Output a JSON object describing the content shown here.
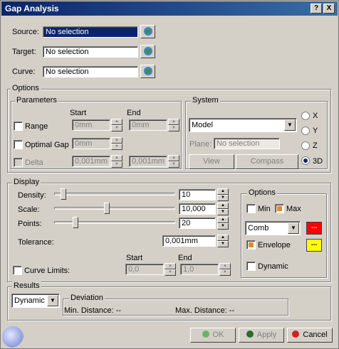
{
  "window": {
    "title": "Gap Analysis",
    "help_label": "?",
    "close_label": "X"
  },
  "inputs": {
    "source": {
      "label": "Source:",
      "value": "No selection"
    },
    "target": {
      "label": "Target:",
      "value": "No selection"
    },
    "curve": {
      "label": "Curve:",
      "value": "No selection"
    }
  },
  "options": {
    "title": "Options",
    "parameters": {
      "title": "Parameters",
      "start_header": "Start",
      "end_header": "End",
      "range": {
        "label": "Range",
        "start": "0mm",
        "end": "0mm"
      },
      "optimal_gap": {
        "label": "Optimal Gap",
        "value": "0mm"
      },
      "delta": {
        "label": "Delta",
        "start": "0,001mm",
        "end": "0,001mm"
      }
    },
    "system": {
      "title": "System",
      "model_value": "Model",
      "plane_label": "Plane:",
      "plane_value": "No selection",
      "view_label": "View",
      "compass_label": "Compass",
      "axes": [
        "X",
        "Y",
        "Z",
        "3D"
      ],
      "selected_axis": "3D"
    }
  },
  "display": {
    "title": "Display",
    "density": {
      "label": "Density:",
      "value": "10"
    },
    "scale": {
      "label": "Scale:",
      "value": "10,000"
    },
    "points": {
      "label": "Points:",
      "value": "20"
    },
    "tolerance": {
      "label": "Tolerance:",
      "value": "0,001mm"
    },
    "curve_limits": {
      "label": "Curve Limits:",
      "start_header": "Start",
      "end_header": "End",
      "start": "0,0",
      "end": "1,0"
    },
    "options": {
      "title": "Options",
      "min_label": "Min",
      "max_label": "Max",
      "comb_value": "Comb",
      "envelope_label": "Envelope",
      "dynamic_label": "Dynamic",
      "swatch_label": "...",
      "colors": {
        "comb": "#ff0000",
        "envelope": "#ffff00"
      }
    }
  },
  "results": {
    "title": "Results",
    "mode_value": "Dynamic",
    "deviation": {
      "title": "Deviation",
      "min_text": "Min. Distance: --",
      "max_text": "Max. Distance: --"
    }
  },
  "footer": {
    "ok_label": "OK",
    "apply_label": "Apply",
    "cancel_label": "Cancel"
  }
}
